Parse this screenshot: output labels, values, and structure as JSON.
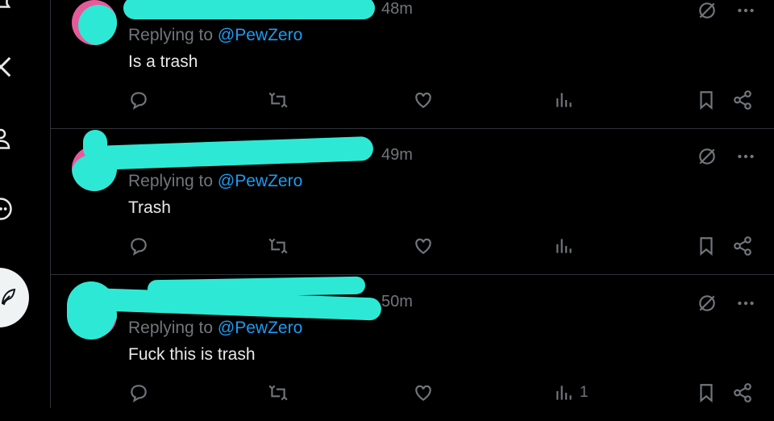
{
  "tweets": [
    {
      "time": "48m",
      "replying_prefix": "Replying to ",
      "mention": "@PewZero",
      "text": "Is a trash",
      "views": ""
    },
    {
      "time": "49m",
      "replying_prefix": "Replying to ",
      "mention": "@PewZero",
      "text": "Trash",
      "views": ""
    },
    {
      "time": "50m",
      "replying_prefix": "Replying to ",
      "mention": "@PewZero",
      "text": "Fuck this is trash",
      "views": "1"
    }
  ],
  "icons": {
    "left_nav": [
      "notifications-icon",
      "x-logo-icon",
      "profile-icon",
      "more-icon"
    ],
    "post_button": "feather-icon",
    "tweet_actions": [
      "reply-icon",
      "retweet-icon",
      "like-icon",
      "views-icon",
      "bookmark-icon",
      "share-icon"
    ],
    "tweet_top": [
      "grok-icon",
      "more-options-icon"
    ]
  },
  "colors": {
    "background": "#000000",
    "text": "#e7e9ea",
    "muted": "#71767b",
    "mention": "#1d9bf0",
    "redaction": "#2ee8d6"
  }
}
